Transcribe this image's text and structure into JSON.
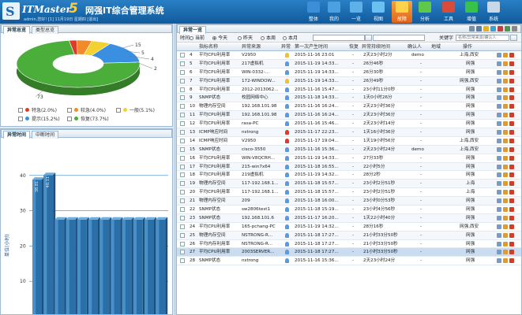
{
  "header": {
    "brand": "ITMaster",
    "brand_num": "5",
    "title": "网强IT综合管理系统",
    "user_info": "admin,您好! [1] 11月19日 星期四 [退出]",
    "nav": [
      {
        "label": "整体",
        "color": "#3a8fd8"
      },
      {
        "label": "我的",
        "color": "#4aa0e0"
      },
      {
        "label": "一览",
        "color": "#5db0e8"
      },
      {
        "label": "视图",
        "color": "#6ac0f0"
      },
      {
        "label": "故障",
        "color": "#ffd24a"
      },
      {
        "label": "分析",
        "color": "#5dc84a"
      },
      {
        "label": "工具",
        "color": "#d84a3a"
      },
      {
        "label": "增值",
        "color": "#37c24a"
      },
      {
        "label": "系统",
        "color": "#c8d8e8"
      }
    ]
  },
  "stat_panel": {
    "tabs": [
      "异常总览",
      "类型总览"
    ],
    "pie_labels": [
      "15",
      "5",
      "4",
      "2",
      "73"
    ],
    "legend": [
      {
        "label": "特急(2.0%)",
        "color": "#e03a2a"
      },
      {
        "label": "较急(4.0%)",
        "color": "#f08a2a"
      },
      {
        "label": "一般(5.1%)",
        "color": "#f2d230"
      },
      {
        "label": "提示(15.2%)",
        "color": "#3a8fe0"
      },
      {
        "label": "恢复(73.7%)",
        "color": "#4cae3a"
      }
    ]
  },
  "time_panel": {
    "tabs": [
      "异常时间",
      "中断时间"
    ],
    "ylabel": "单位(小时)",
    "yticks": [
      "40",
      "30",
      "20",
      "10"
    ]
  },
  "chart_data": {
    "type": "bar",
    "ylabel": "单位(小时)",
    "ylim": [
      0,
      50
    ],
    "bar_labels": [
      "38.81",
      "40.11",
      "",
      "",
      "",
      "",
      "",
      "",
      "",
      "",
      "",
      ""
    ],
    "values": [
      38.81,
      40.11,
      27.5,
      27.5,
      27.5,
      27.5,
      27.5,
      27.5,
      27.5,
      27.5,
      27.5,
      27.5
    ]
  },
  "list_panel": {
    "tabs": [
      "异常一览"
    ],
    "filter": {
      "time_label": "时间",
      "options": [
        "当前",
        "今天",
        "昨天",
        "本周",
        "本月"
      ],
      "selected": "今天",
      "keyword_label": "关键字",
      "keyword_placeholder": "名称/异常来源/确认人"
    },
    "columns": [
      "",
      "",
      "指标名称",
      "异常来源",
      "异常",
      "第一次产生时间",
      "恢复",
      "异常持续时间",
      "确认人",
      "地域",
      "操作"
    ],
    "rows": [
      {
        "n": "4",
        "name": "平均CPU利用率",
        "src": "V2950",
        "c": "#f0c030",
        "t": "2015-11-16 23:01",
        "r": "-",
        "d": "2天23小时2分",
        "u": "demo",
        "area": "上海,西安"
      },
      {
        "n": "5",
        "name": "平均CPU利用率",
        "src": "217虚拟机",
        "c": "#5a9ae0",
        "t": "2015-11-19 14:33...",
        "r": "-",
        "d": "26分46秒",
        "u": "-",
        "area": "网强"
      },
      {
        "n": "6",
        "name": "平均CPU利用率",
        "src": "WIN-0332-...",
        "c": "#5a9ae0",
        "t": "2015-11-19 14:33...",
        "r": "-",
        "d": "26分30秒",
        "u": "-",
        "area": "网强"
      },
      {
        "n": "7",
        "name": "平均CPU利用率",
        "src": "172-WINDOW...",
        "c": "#f0c030",
        "t": "2015-11-19 14:33...",
        "r": "-",
        "d": "26分49秒",
        "u": "-",
        "area": "网强,西安"
      },
      {
        "n": "8",
        "name": "平均CPU利用率",
        "src": "2012-2013062...",
        "c": "#5a9ae0",
        "t": "2015-11-16 15:47...",
        "r": "-",
        "d": "23小时11分0秒",
        "u": "-",
        "area": "网强"
      },
      {
        "n": "9",
        "name": "SNMP状态",
        "src": "校园网络中心",
        "c": "#5a9ae0",
        "t": "2015-11-18 14:33...",
        "r": "-",
        "d": "1天0小时26分",
        "u": "-",
        "area": "网强"
      },
      {
        "n": "10",
        "name": "物理内存空间",
        "src": "192.168.101.98",
        "c": "#5a9ae0",
        "t": "2015-11-16 16:24...",
        "r": "-",
        "d": "2天23小时36分",
        "u": "-",
        "area": "网强"
      },
      {
        "n": "11",
        "name": "平均CPU利用率",
        "src": "192.168.101.98",
        "c": "#5a9ae0",
        "t": "2015-11-16 16:24...",
        "r": "-",
        "d": "2天23小时36分",
        "u": "-",
        "area": "网强"
      },
      {
        "n": "12",
        "name": "平均CPU利用率",
        "src": "rasa-PC",
        "c": "#5a9ae0",
        "t": "2015-11-16 15:46...",
        "r": "-",
        "d": "2天23小时14分",
        "u": "-",
        "area": "网强"
      },
      {
        "n": "13",
        "name": "ICMP响应时间",
        "src": "nstrong",
        "c": "#e03a2a",
        "t": "2015-11-17 22:23...",
        "r": "-",
        "d": "1天16小时36分",
        "u": "-",
        "area": "网强"
      },
      {
        "n": "14",
        "name": "ICMP响应时间",
        "src": "V2950",
        "c": "#e03a2a",
        "t": "2015-11-17 19:04...",
        "r": "-",
        "d": "1天19小时56分",
        "u": "-",
        "area": "上海,西安"
      },
      {
        "n": "15",
        "name": "SNMP状态",
        "src": "cisco-3550",
        "c": "#5a9ae0",
        "t": "2015-11-16 15:36...",
        "r": "-",
        "d": "2天23小时24分",
        "u": "demo",
        "area": "上海,西安"
      },
      {
        "n": "16",
        "name": "平均CPU利用率",
        "src": "WIN-V8QCRH...",
        "c": "#5a9ae0",
        "t": "2015-11-19 14:33...",
        "r": "-",
        "d": "27分33秒",
        "u": "-",
        "area": "网强"
      },
      {
        "n": "17",
        "name": "平均CPU利用率",
        "src": "215-win7x64",
        "c": "#5a9ae0",
        "t": "2015-11-18 16:55...",
        "r": "-",
        "d": "22小时5分",
        "u": "-",
        "area": "网强"
      },
      {
        "n": "18",
        "name": "平均CPU利用率",
        "src": "219虚拟机",
        "c": "#5a9ae0",
        "t": "2015-11-19 14:32...",
        "r": "-",
        "d": "28分2秒",
        "u": "-",
        "area": "网强"
      },
      {
        "n": "19",
        "name": "物理内存空间",
        "src": "117-192.168.1...",
        "c": "#5a9ae0",
        "t": "2015-11-18 15:57...",
        "r": "-",
        "d": "23小时2分51秒",
        "u": "-",
        "area": "上海"
      },
      {
        "n": "20",
        "name": "平均CPU利用率",
        "src": "117-192.168.1...",
        "c": "#5a9ae0",
        "t": "2015-11-18 15:57...",
        "r": "-",
        "d": "23小时2分51秒",
        "u": "-",
        "area": "上海"
      },
      {
        "n": "21",
        "name": "物理内存空间",
        "src": "209",
        "c": "#5a9ae0",
        "t": "2015-11-18 16:00...",
        "r": "-",
        "d": "23小时0分53秒",
        "u": "-",
        "area": "网强"
      },
      {
        "n": "22",
        "name": "SNMP状态",
        "src": "sw2806test1",
        "c": "#5a9ae0",
        "t": "2015-11-18 15:19...",
        "r": "-",
        "d": "23小时4分56秒",
        "u": "-",
        "area": "网强"
      },
      {
        "n": "23",
        "name": "SNMP状态",
        "src": "192.168.101.6",
        "c": "#5a9ae0",
        "t": "2015-11-17 16:20...",
        "r": "-",
        "d": "1天22小时40分",
        "u": "-",
        "area": "网强"
      },
      {
        "n": "24",
        "name": "平均CPU利用率",
        "src": "165-pchang-PC",
        "c": "#5a9ae0",
        "t": "2015-11-19 14:32...",
        "r": "-",
        "d": "28分16秒",
        "u": "-",
        "area": "网强,西安"
      },
      {
        "n": "25",
        "name": "物理内存空间",
        "src": "NSTRONG-R...",
        "c": "#5a9ae0",
        "t": "2015-11-18 17:27...",
        "r": "-",
        "d": "21小时33分50秒",
        "u": "-",
        "area": "网强"
      },
      {
        "n": "26",
        "name": "平均内存利用率",
        "src": "NSTRONG-R...",
        "c": "#5a9ae0",
        "t": "2015-11-18 17:27...",
        "r": "-",
        "d": "21小时33分50秒",
        "u": "-",
        "area": "网强"
      },
      {
        "n": "27",
        "name": "平均CPU利用率",
        "src": "2003SERVER...",
        "c": "#5a9ae0",
        "t": "2015-11-18 17:27...",
        "r": "-",
        "d": "21小时33分50秒",
        "u": "-",
        "area": "网强"
      },
      {
        "n": "28",
        "name": "SNMP状态",
        "src": "nstrong",
        "c": "#5a9ae0",
        "t": "2015-11-16 15:36...",
        "r": "-",
        "d": "2天23小时24分",
        "u": "-",
        "area": "网强"
      }
    ]
  }
}
